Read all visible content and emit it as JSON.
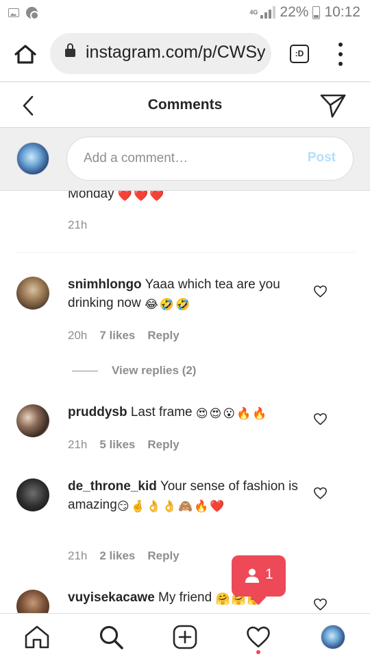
{
  "status_bar": {
    "network": "4G",
    "battery": "22%",
    "time": "10:12"
  },
  "browser": {
    "url": "instagram.com/p/CWSy",
    "tab_label": ":D"
  },
  "header": {
    "title": "Comments"
  },
  "add_comment": {
    "placeholder": "Add a comment…",
    "post_label": "Post"
  },
  "comments": [
    {
      "username": "",
      "text": "Monday",
      "emojis": "❤️❤️❤️",
      "time": "21h",
      "likes": "",
      "reply_label": ""
    },
    {
      "username": "snimhlongo",
      "text": "Yaaa which tea are you drinking now",
      "emojis": "😂🤣🤣",
      "time": "20h",
      "likes": "7 likes",
      "reply_label": "Reply",
      "view_replies": "View replies (2)"
    },
    {
      "username": "pruddysb",
      "text": "Last frame",
      "emojis": "😍😍😮🔥🔥",
      "time": "21h",
      "likes": "5 likes",
      "reply_label": "Reply"
    },
    {
      "username": "de_throne_kid",
      "text": "Your sense of fashion is amazing",
      "emojis": "😏🤞👌👌🙈🔥❤️",
      "time": "21h",
      "likes": "2 likes",
      "reply_label": "Reply"
    },
    {
      "username": "vuyisekacawe",
      "text": "My friend",
      "emojis": "🤗🤗🤗",
      "time": "",
      "likes": "",
      "reply_label": ""
    }
  ],
  "notification": {
    "count": "1"
  },
  "colors": {
    "accent": "#0095f6",
    "post_disabled": "#b2dffc",
    "notification": "#ed4956",
    "heart_red": "#ed4956",
    "muted_text": "#8e8e8e"
  },
  "icons": [
    "home-icon",
    "lock-icon",
    "tabs-icon",
    "more-vert-icon",
    "back-icon",
    "direct-send-icon",
    "heart-outline-icon",
    "user-icon",
    "search-icon",
    "new-post-icon",
    "activity-heart-icon",
    "profile-avatar"
  ]
}
